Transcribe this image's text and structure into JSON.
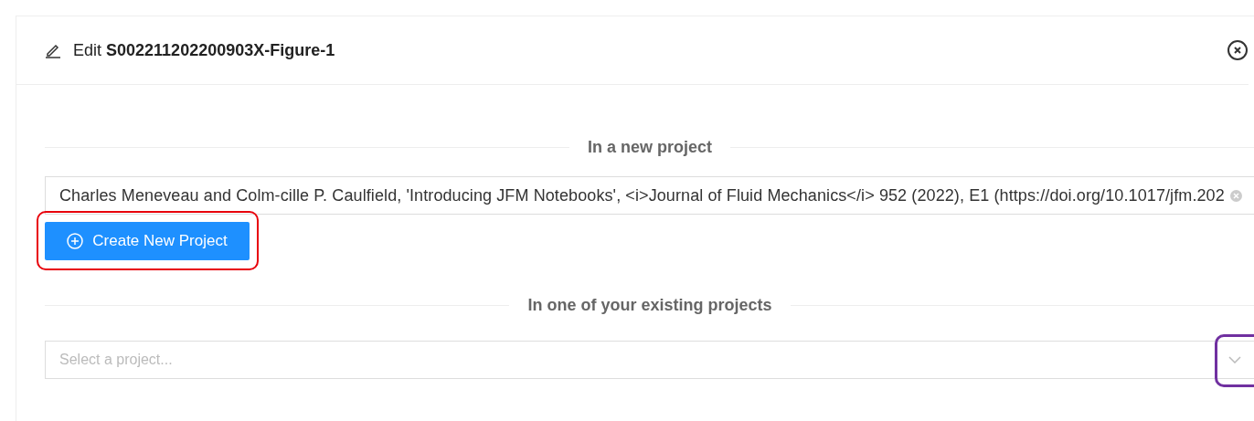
{
  "dialog": {
    "title_prefix": "Edit",
    "title_name": "S002211202200903X-Figure-1"
  },
  "new_project": {
    "heading": "In a new project",
    "citation": "Charles Meneveau and Colm-cille P. Caulfield, 'Introducing JFM Notebooks', <i>Journal of Fluid Mechanics</i> 952 (2022), E1 (https://doi.org/10.1017/jfm.202",
    "button": "Create New Project"
  },
  "existing_project": {
    "heading": "In one of your existing projects",
    "placeholder": "Select a project..."
  }
}
